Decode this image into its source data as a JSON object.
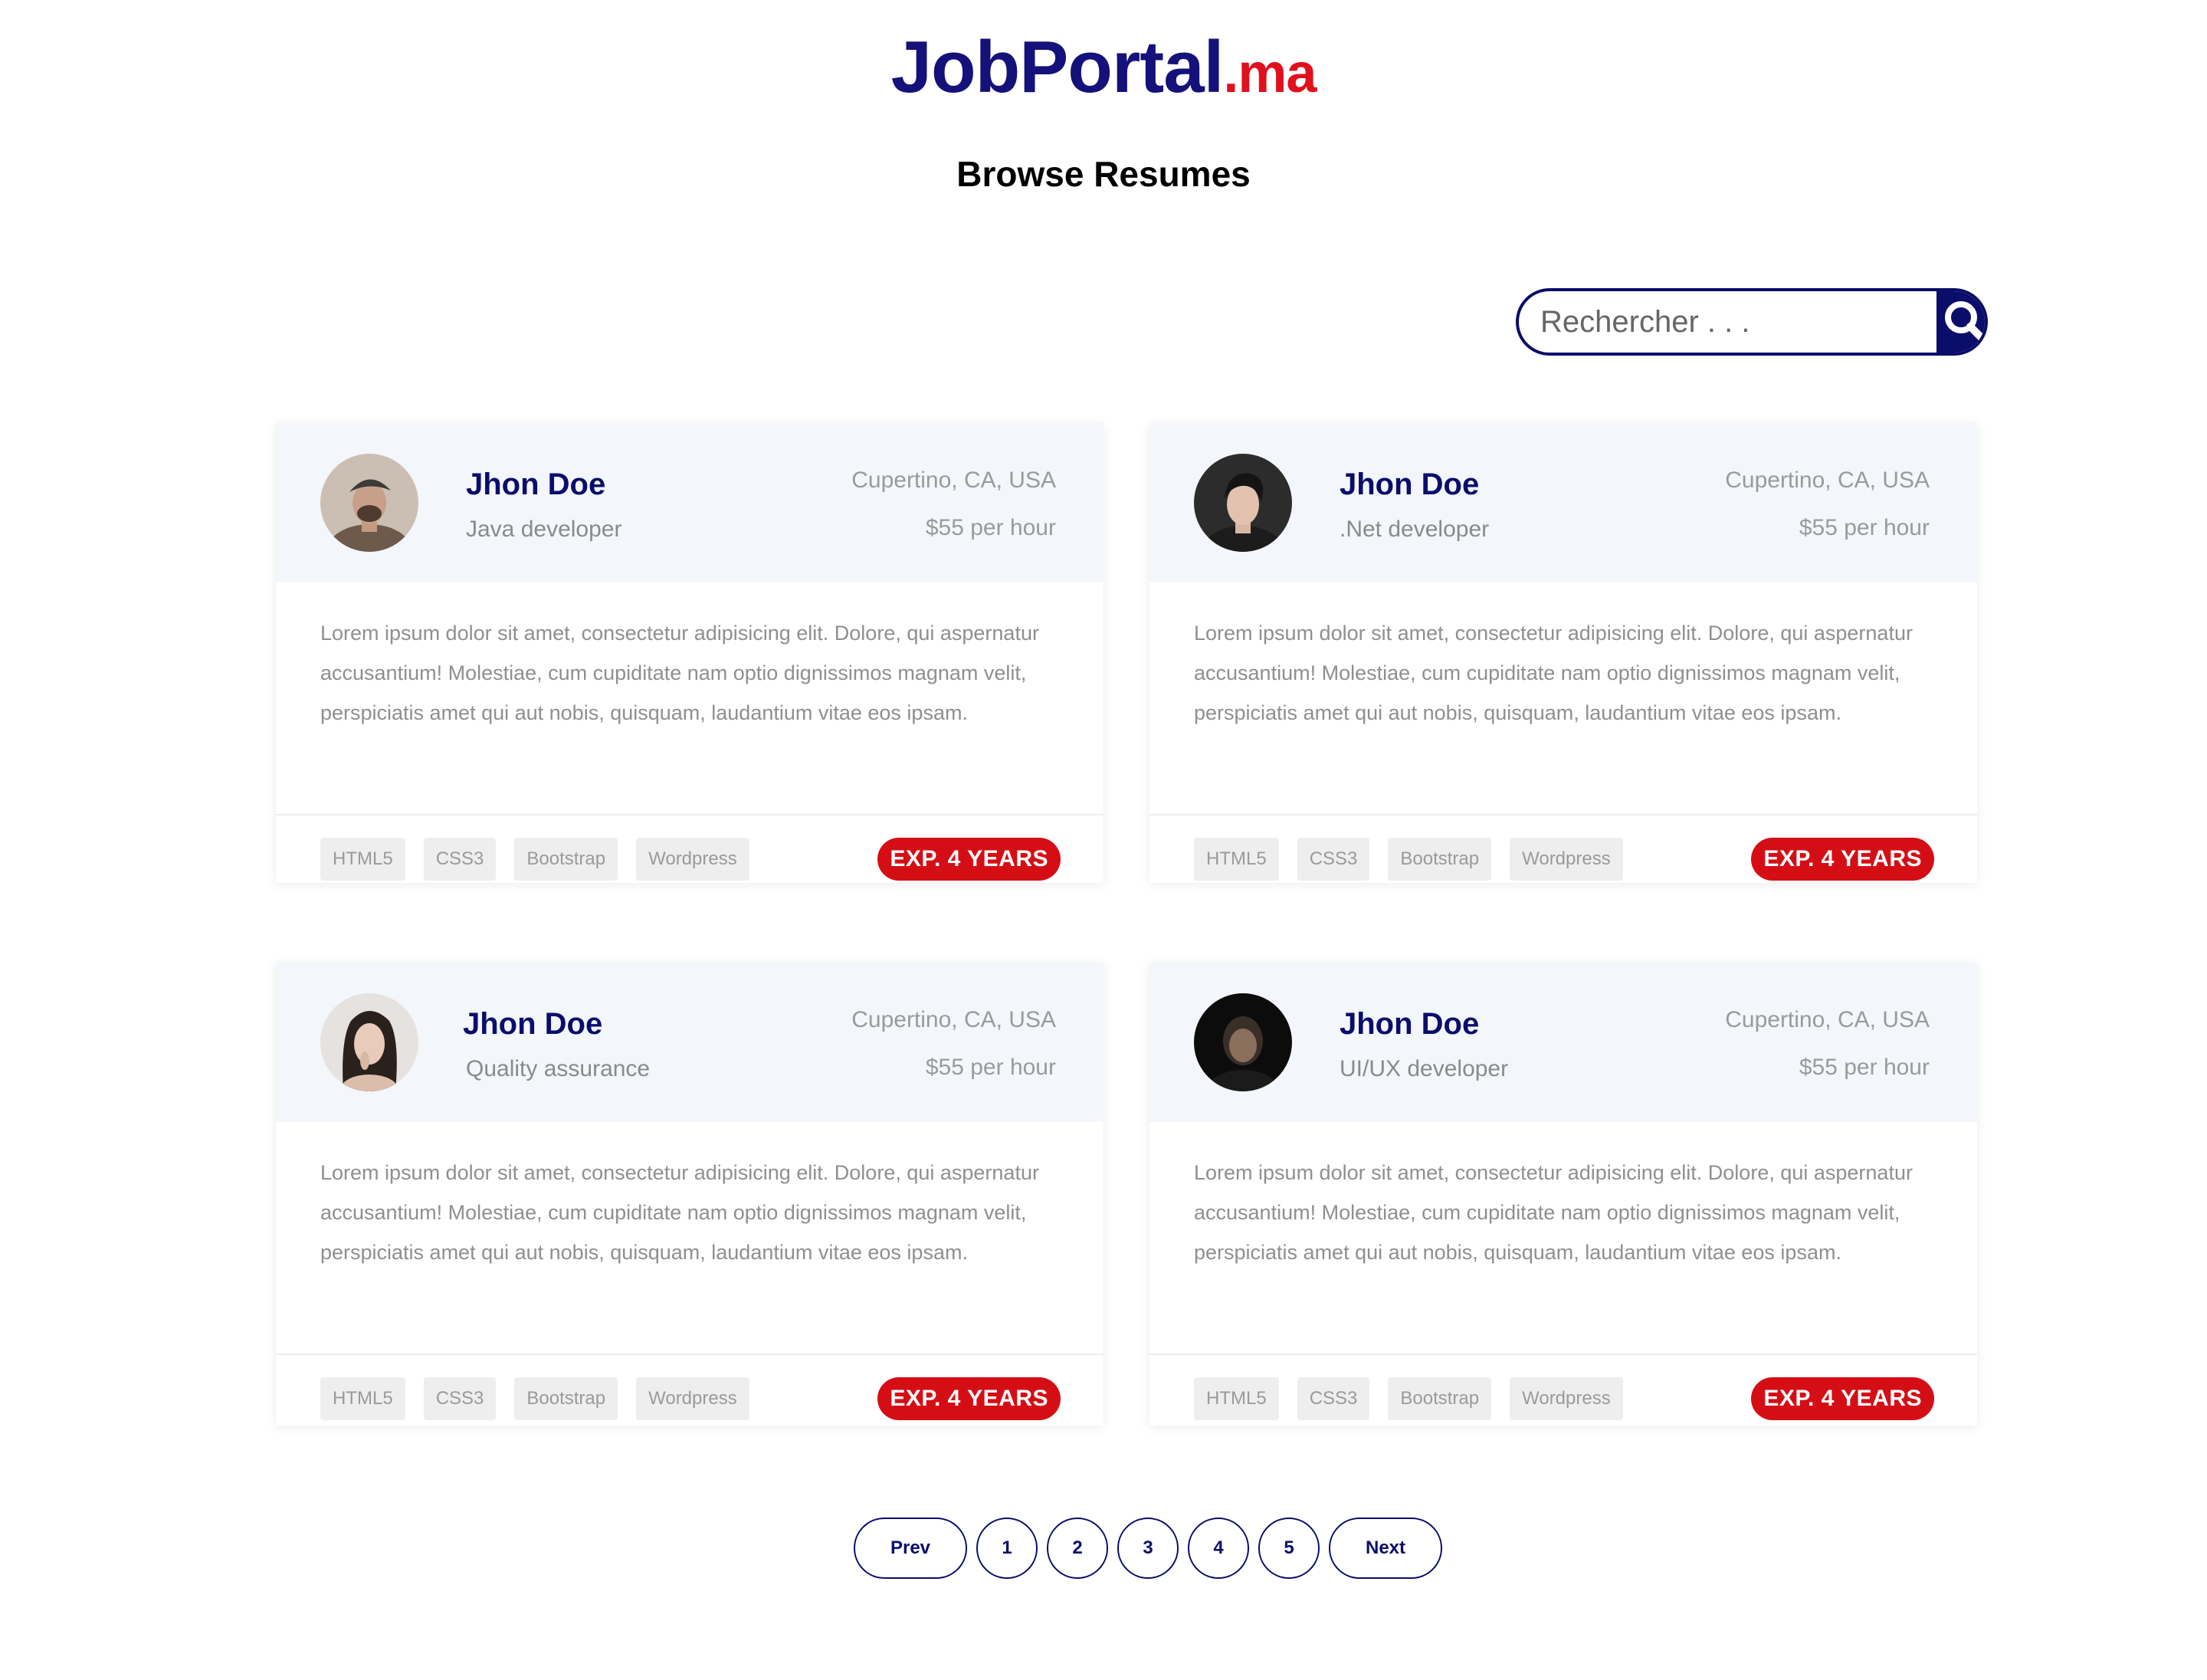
{
  "brand": {
    "name": "JobPortal",
    "tld": ".ma",
    "primary_color": "#14117a",
    "accent_color": "#e0101d"
  },
  "page": {
    "title": "Browse Resumes"
  },
  "search": {
    "placeholder": "Rechercher . . .",
    "icon": "search-icon"
  },
  "resumes": [
    {
      "name": "Jhon Doe",
      "role": "Java developer",
      "location": "Cupertino, CA, USA",
      "rate": "$55 per hour",
      "description": "Lorem ipsum dolor sit amet, consectetur adipisicing elit. Dolore, qui aspernatur accusantium! Molestiae, cum cupiditate nam optio dignissimos magnam velit, perspiciatis amet qui aut nobis, quisquam, laudantium vitae eos ipsam.",
      "tags": [
        "HTML5",
        "CSS3",
        "Bootstrap",
        "Wordpress"
      ],
      "experience": "EXP. 4 YEARS"
    },
    {
      "name": "Jhon Doe",
      "role": ".Net developer",
      "location": "Cupertino, CA, USA",
      "rate": "$55 per hour",
      "description": "Lorem ipsum dolor sit amet, consectetur adipisicing elit. Dolore, qui aspernatur accusantium! Molestiae, cum cupiditate nam optio dignissimos magnam velit, perspiciatis amet qui aut nobis, quisquam, laudantium vitae eos ipsam.",
      "tags": [
        "HTML5",
        "CSS3",
        "Bootstrap",
        "Wordpress"
      ],
      "experience": "EXP. 4 YEARS"
    },
    {
      "name": "Jhon Doe",
      "role": "Quality assurance",
      "location": "Cupertino, CA, USA",
      "rate": "$55 per hour",
      "description": "Lorem ipsum dolor sit amet, consectetur adipisicing elit. Dolore, qui aspernatur accusantium! Molestiae, cum cupiditate nam optio dignissimos magnam velit, perspiciatis amet qui aut nobis, quisquam, laudantium vitae eos ipsam.",
      "tags": [
        "HTML5",
        "CSS3",
        "Bootstrap",
        "Wordpress"
      ],
      "experience": "EXP. 4 YEARS"
    },
    {
      "name": "Jhon Doe",
      "role": "UI/UX developer",
      "location": "Cupertino, CA, USA",
      "rate": "$55 per hour",
      "description": "Lorem ipsum dolor sit amet, consectetur adipisicing elit. Dolore, qui aspernatur accusantium! Molestiae, cum cupiditate nam optio dignissimos magnam velit, perspiciatis amet qui aut nobis, quisquam, laudantium vitae eos ipsam.",
      "tags": [
        "HTML5",
        "CSS3",
        "Bootstrap",
        "Wordpress"
      ],
      "experience": "EXP. 4 YEARS"
    }
  ],
  "pagination": {
    "prev": "Prev",
    "pages": [
      "1",
      "2",
      "3",
      "4",
      "5"
    ],
    "next": "Next"
  }
}
